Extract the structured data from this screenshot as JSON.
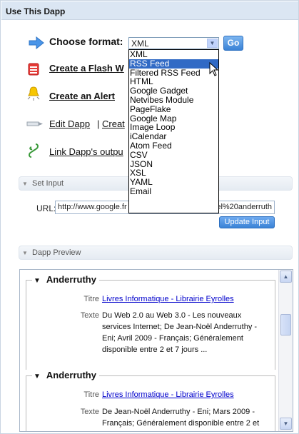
{
  "panel": {
    "title": "Use This Dapp"
  },
  "format": {
    "label": "Choose format:",
    "selected": "XML",
    "go_label": "Go",
    "options": [
      "XML",
      "RSS Feed",
      "Filtered RSS Feed",
      "HTML",
      "Google Gadget",
      "Netvibes Module",
      "PageFlake",
      "Google Map",
      "Image Loop",
      "iCalendar",
      "Atom Feed",
      "CSV",
      "JSON",
      "XSL",
      "YAML",
      "Email"
    ],
    "highlighted": "RSS Feed"
  },
  "actions": {
    "flash": "Create a Flash W",
    "alert": "Create an Alert",
    "edit": "Edit Dapp",
    "separator": "|",
    "create": "Creat",
    "link": "Link Dapp's outpu"
  },
  "set_input": {
    "header": "Set Input",
    "url_label": "URL:",
    "url_value_visible_left": "http://www.google.fr",
    "url_value_visible_right": "20noel%20anderruth",
    "update_label": "Update Input"
  },
  "preview": {
    "header": "Dapp Preview",
    "items": [
      {
        "title": "Anderruthy",
        "titre_label": "Titre",
        "titre_value": "Livres Informatique - Librairie Eyrolles",
        "texte_label": "Texte",
        "texte_lines": [
          "Du Web 2.0 au Web 3.0 - Les nouveaux",
          "services Internet; De Jean-Noël Anderruthy -",
          "Eni; Avril 2009 - Français; Généralement",
          "disponible entre 2 et 7 jours ..."
        ]
      },
      {
        "title": "Anderruthy",
        "titre_label": "Titre",
        "titre_value": "Livres Informatique - Librairie Eyrolles",
        "texte_label": "Texte",
        "texte_lines": [
          "De Jean-Noël Anderruthy - Eni; Mars 2009 -",
          "Français; Généralement disponible entre 2 et"
        ]
      }
    ]
  },
  "icons": {
    "arrow": "right-arrow-icon",
    "flash": "flash-widget-icon",
    "alert": "bell-alert-icon",
    "edit": "pencil-icon",
    "link": "link-icon"
  },
  "colors": {
    "accent": "#3a82d6",
    "header_bg": "#dbe6f3",
    "selected": "#316ac5"
  }
}
